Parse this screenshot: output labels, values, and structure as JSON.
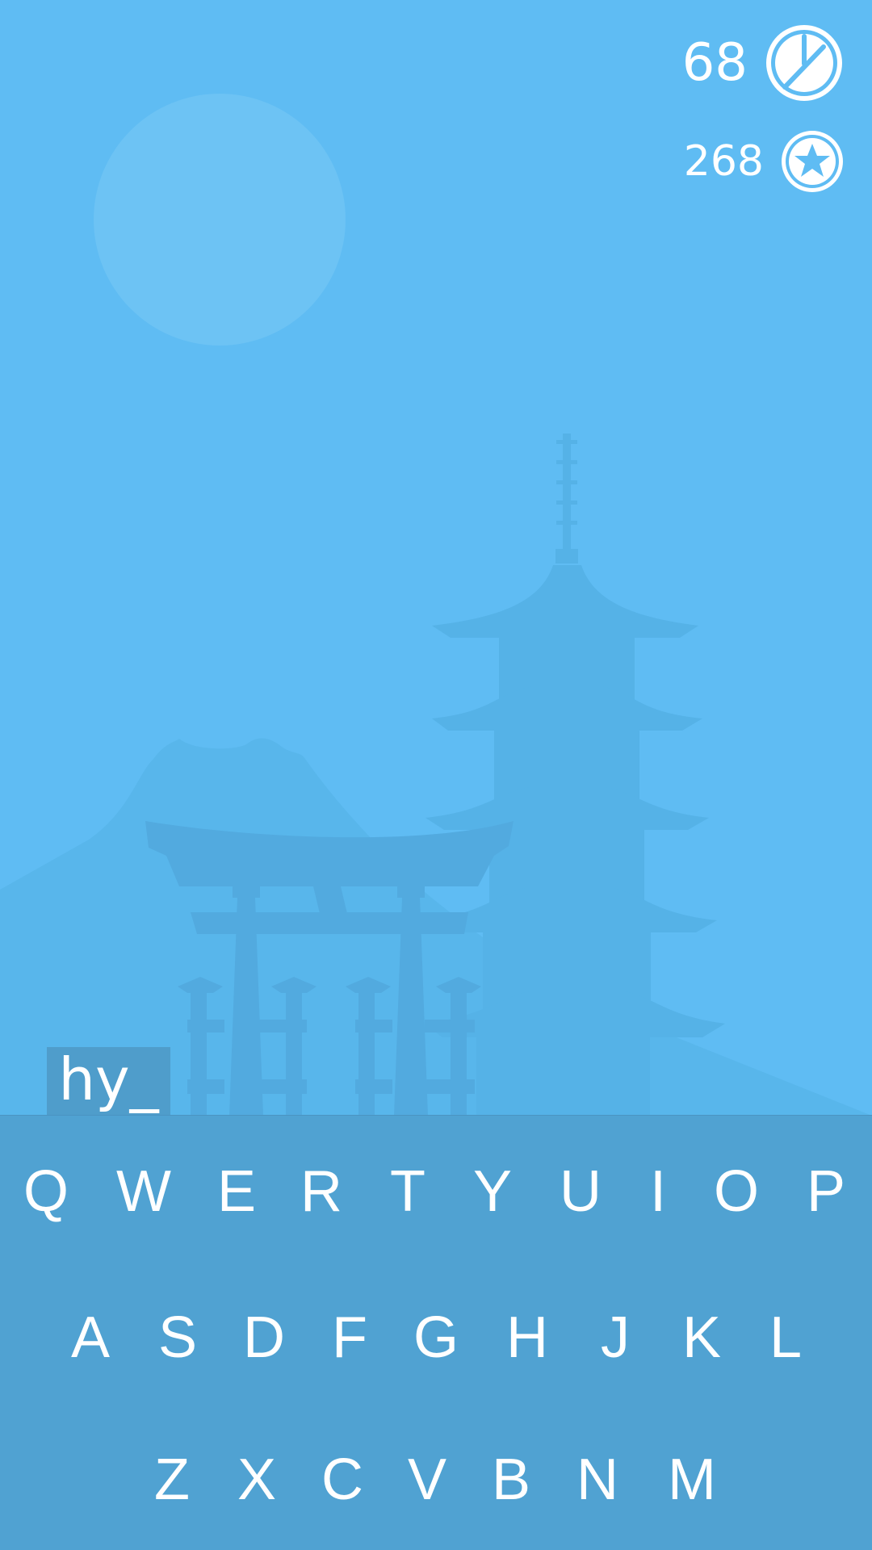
{
  "hud": {
    "timer_value": "68",
    "stars_value": "268",
    "timer_icon": "timer-dial-icon",
    "stars_icon": "star-coin-icon"
  },
  "word": {
    "current": "hy_"
  },
  "keyboard": {
    "rows": [
      [
        "Q",
        "W",
        "E",
        "R",
        "T",
        "Y",
        "U",
        "I",
        "O",
        "P"
      ],
      [
        "A",
        "S",
        "D",
        "F",
        "G",
        "H",
        "J",
        "K",
        "L"
      ],
      [
        "Z",
        "X",
        "C",
        "V",
        "B",
        "N",
        "M"
      ]
    ]
  },
  "colors": {
    "sky": "#5fbcf3",
    "keyboard": "#50a2d2",
    "word_box": "#4f9dcb",
    "text": "#ffffff"
  }
}
